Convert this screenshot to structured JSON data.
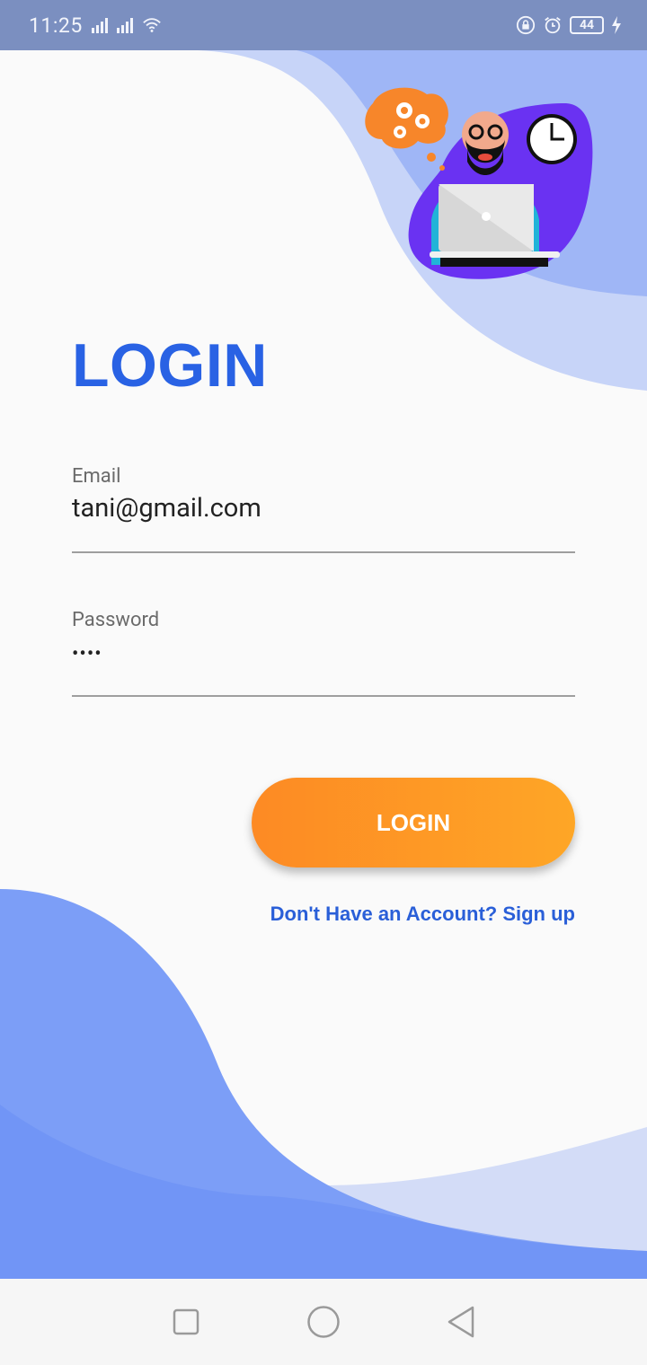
{
  "status_bar": {
    "time": "11:25",
    "battery_level": "44",
    "icons": [
      "signal-icon",
      "signal-icon",
      "wifi-icon",
      "lock-rotation-icon",
      "alarm-icon",
      "battery-icon",
      "charging-icon"
    ]
  },
  "login": {
    "title": "LOGIN",
    "email_label": "Email",
    "email_value": "tani@gmail.com",
    "password_label": "Password",
    "password_masked": "••••",
    "button_label": "LOGIN",
    "signup_text": "Don't Have an Account? Sign up"
  },
  "nav_bar": {
    "icons": [
      "recent-apps-icon",
      "home-icon",
      "back-icon"
    ]
  },
  "colors": {
    "accent_blue": "#2962e4",
    "button_start": "#fd8a24",
    "button_end": "#fea626",
    "wave_dark": "#6b93f5",
    "wave_light": "#c5d3f8"
  }
}
